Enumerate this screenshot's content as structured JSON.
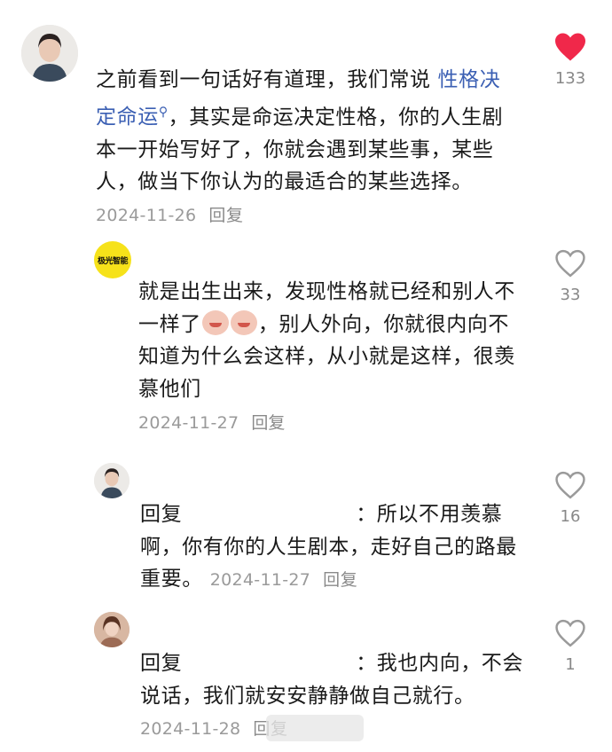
{
  "comments": [
    {
      "text_before": "之前看到一句话好有道理，我们常说 ",
      "mention": "性格决定命运",
      "text_after": "，其实是命运决定性格，你的人生剧本一开始写好了，你就会遇到某些事，某些人，做当下你认为的最适合的某些选择。",
      "date": "2024-11-26",
      "reply": "回复",
      "likes": "133",
      "liked": true
    },
    {
      "avatar_text": "极光智能",
      "text_a": "就是出生出来，发现性格就已经和别人不一样了",
      "text_b": "，别人外向，你就很内向不知道为什么会这样，从小就是这样，很羡慕他们",
      "date": "2024-11-27",
      "reply": "回复",
      "likes": "33"
    },
    {
      "prefix": "回复",
      "text": "：所以不用羡慕啊，你有你的人生剧本，走好自己的路最重要。",
      "date": "2024-11-27",
      "reply": "回复",
      "likes": "16"
    },
    {
      "prefix": "回复",
      "text": "：我也内向，不会说话，我们就安安静静做自己就行。",
      "date": "2024-11-28",
      "reply": "回复",
      "likes": "1"
    }
  ],
  "colors": {
    "liked": "#f0284a",
    "mention": "#3b5fb3",
    "meta": "#9a9a9a"
  },
  "icons": [
    "heart-filled-icon",
    "heart-outline-icon",
    "search-icon",
    "crying-emoji-icon"
  ]
}
